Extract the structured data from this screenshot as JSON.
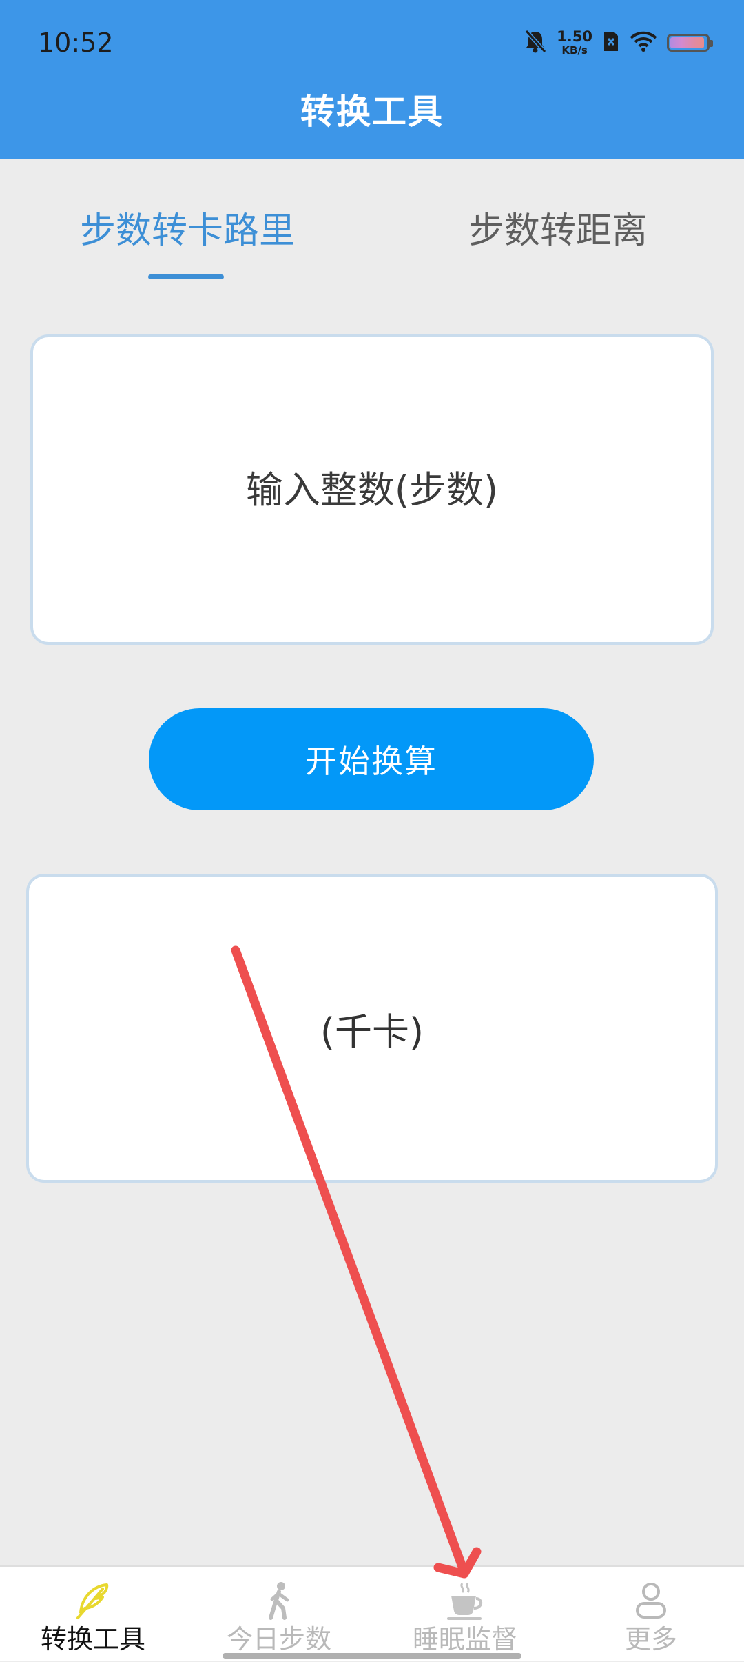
{
  "status_bar": {
    "time": "10:52",
    "network_speed_value": "1.50",
    "network_speed_unit": "KB/s",
    "battery_level": 0.95
  },
  "header": {
    "title": "转换工具"
  },
  "tabs": [
    {
      "label": "步数转卡路里",
      "active": true
    },
    {
      "label": "步数转距离",
      "active": false
    }
  ],
  "input": {
    "placeholder": "输入整数(步数)",
    "value": ""
  },
  "convert_button": {
    "label": "开始换算"
  },
  "result": {
    "text": "(千卡)"
  },
  "bottom_nav": [
    {
      "label": "转换工具",
      "icon": "feather-icon",
      "active": true
    },
    {
      "label": "今日步数",
      "icon": "walking-person-icon",
      "active": false
    },
    {
      "label": "睡眠监督",
      "icon": "coffee-cup-icon",
      "active": false
    },
    {
      "label": "更多",
      "icon": "person-icon",
      "active": false
    }
  ],
  "colors": {
    "header": "#3d96e8",
    "accent": "#3d8fd6",
    "button": "#0398f8",
    "active_nav_icon": "#f2e34a",
    "annotation_arrow": "#ee4f4f"
  }
}
